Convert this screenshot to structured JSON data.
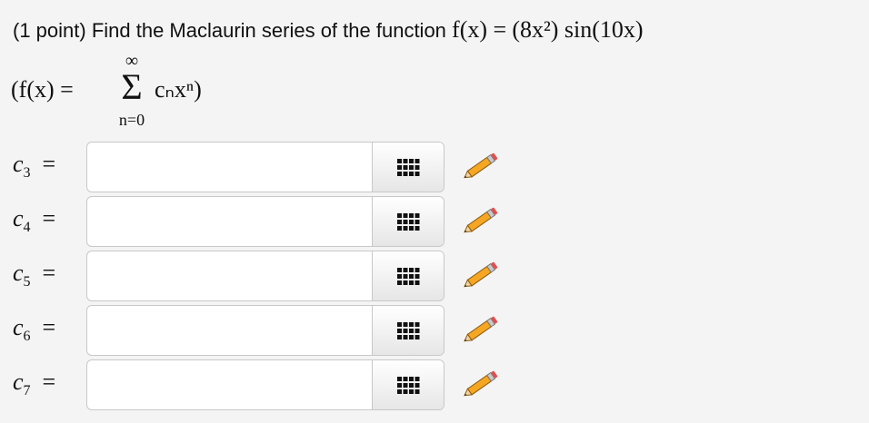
{
  "problem": {
    "prefix": "(1 point) Find the Maclaurin series of the function",
    "function_lhs": "f(x) =",
    "function_rhs": "(8x²) sin(10x)"
  },
  "series": {
    "lhs": "(f(x) =",
    "sigma": "Σ",
    "upper": "∞",
    "lower": "n=0",
    "term": "cₙxⁿ)"
  },
  "rows": [
    {
      "label": "c",
      "sub": "3",
      "eq": "=",
      "value": ""
    },
    {
      "label": "c",
      "sub": "4",
      "eq": "=",
      "value": ""
    },
    {
      "label": "c",
      "sub": "5",
      "eq": "=",
      "value": ""
    },
    {
      "label": "c",
      "sub": "6",
      "eq": "=",
      "value": ""
    },
    {
      "label": "c",
      "sub": "7",
      "eq": "=",
      "value": ""
    }
  ],
  "icons": {
    "palette": "equation-palette-icon",
    "pencil": "pencil-icon"
  },
  "colors": {
    "background": "#f4f4f4",
    "pencil_body": "#f5a623",
    "pencil_tip": "#e05050"
  }
}
